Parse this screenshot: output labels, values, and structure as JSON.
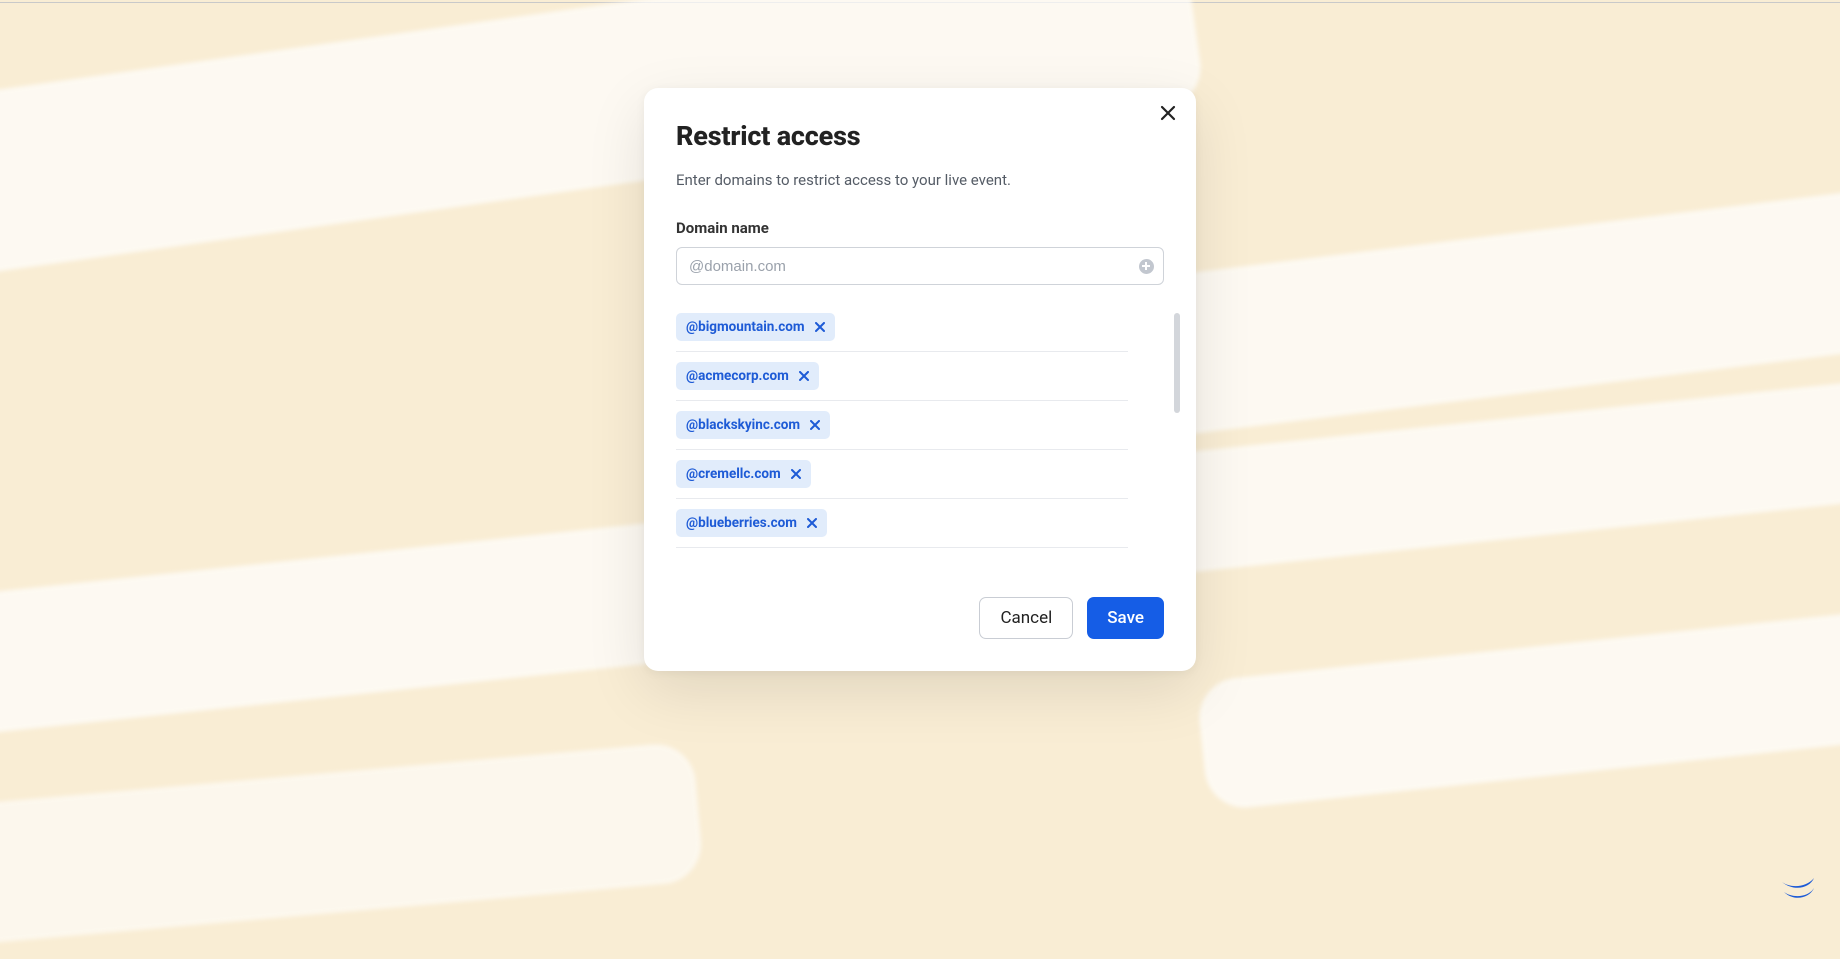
{
  "modal": {
    "title": "Restrict access",
    "description": "Enter domains to restrict access to your live event.",
    "field_label": "Domain name",
    "input_placeholder": "@domain.com",
    "cancel_label": "Cancel",
    "save_label": "Save"
  },
  "domains": [
    {
      "label": "@bigmountain.com"
    },
    {
      "label": "@acmecorp.com"
    },
    {
      "label": "@blackskyinc.com"
    },
    {
      "label": "@cremellc.com"
    },
    {
      "label": "@blueberries.com"
    }
  ],
  "icons": {
    "close": "close-icon",
    "add": "plus-circle-icon",
    "chip_remove": "close-icon",
    "brand": "brand-logo"
  },
  "colors": {
    "accent": "#155de6",
    "chip_bg": "#e1ecfb",
    "chip_text": "#1e5bd6",
    "page_bg": "#f9edd4"
  }
}
